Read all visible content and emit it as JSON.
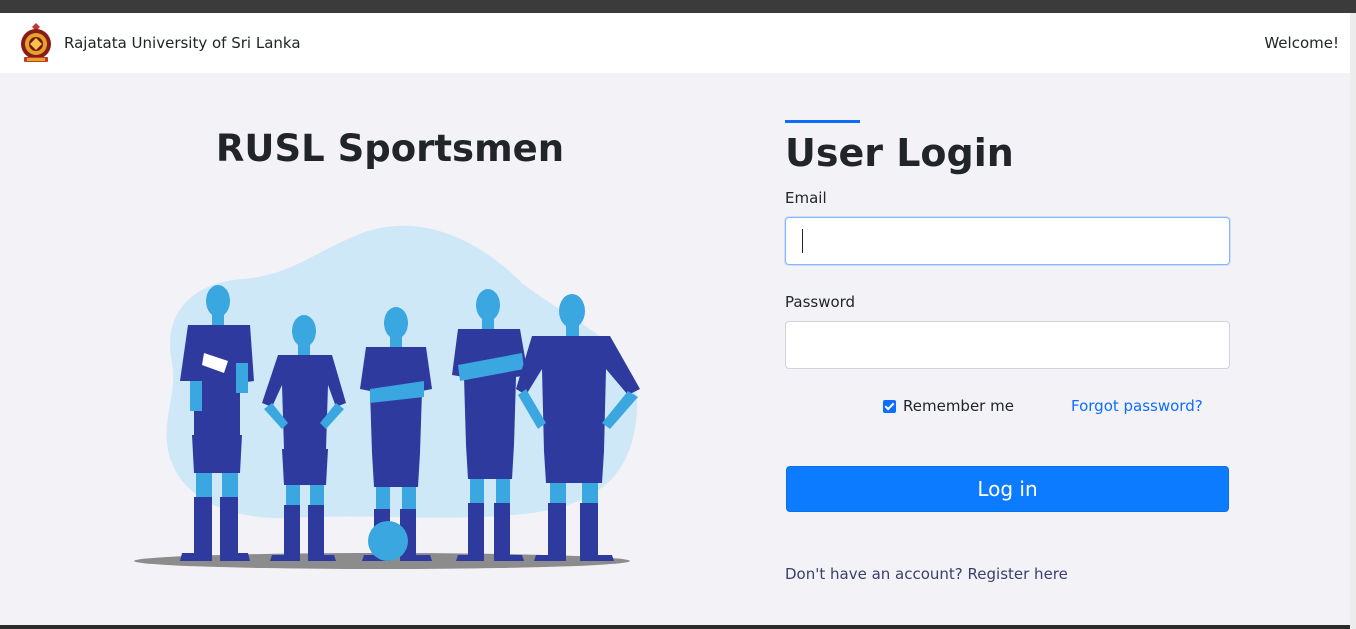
{
  "navbar": {
    "brand": "Rajatata University of Sri Lanka",
    "welcome": "Welcome!"
  },
  "hero": {
    "title": "RUSL Sportsmen"
  },
  "login": {
    "title": "User Login",
    "email_label": "Email",
    "email_value": "",
    "password_label": "Password",
    "password_value": "",
    "remember_label": "Remember me",
    "remember_checked": true,
    "forgot_link": "Forgot password?",
    "submit_label": "Log in",
    "register_text": "Don't have an account? Register here"
  },
  "colors": {
    "accent": "#0d6efd",
    "background": "#f3f2f7",
    "player_jersey": "#2e3a9e",
    "player_skin": "#3aa7e0",
    "blob": "#cfe8f7"
  },
  "icons": {
    "logo": "university-crest-icon",
    "checkbox": "checkmark-icon"
  }
}
